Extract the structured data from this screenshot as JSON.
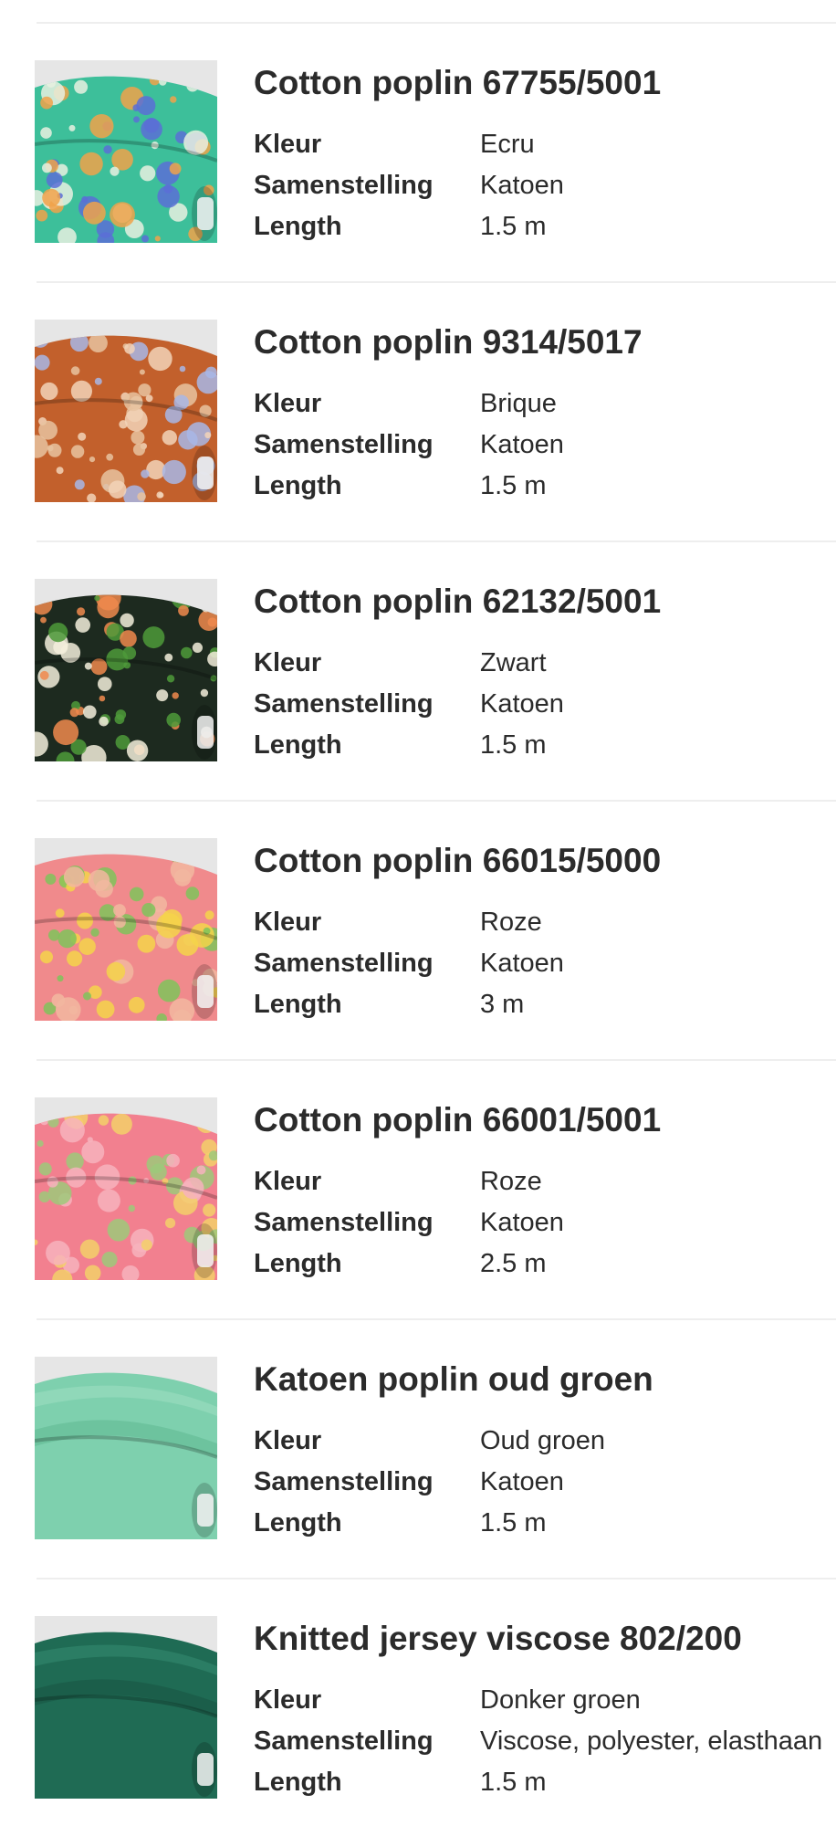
{
  "labels": {
    "kleur": "Kleur",
    "samenstelling": "Samenstelling",
    "length": "Length"
  },
  "products": [
    {
      "title": "Cotton poplin 67755/5001",
      "kleur": "Ecru",
      "samenstelling": "Katoen",
      "length": "1.5 m",
      "colors": {
        "base": "#3dbf9a",
        "accent1": "#5a6fd6",
        "accent2": "#f0a24a",
        "accent3": "#e8f0e0"
      }
    },
    {
      "title": "Cotton poplin 9314/5017",
      "kleur": "Brique",
      "samenstelling": "Katoen",
      "length": "1.5 m",
      "colors": {
        "base": "#c2602c",
        "accent1": "#f2d3b8",
        "accent2": "#a8b7e6",
        "accent3": "#e7c3a0"
      }
    },
    {
      "title": "Cotton poplin 62132/5001",
      "kleur": "Zwart",
      "samenstelling": "Katoen",
      "length": "1.5 m",
      "colors": {
        "base": "#1d2a1f",
        "accent1": "#4d9a3a",
        "accent2": "#f08a4e",
        "accent3": "#f3eedc"
      }
    },
    {
      "title": "Cotton poplin 66015/5000",
      "kleur": "Roze",
      "samenstelling": "Katoen",
      "length": "3 m",
      "colors": {
        "base": "#f08a8c",
        "accent1": "#f4d34a",
        "accent2": "#7fc35a",
        "accent3": "#f2b7a0"
      }
    },
    {
      "title": "Cotton poplin 66001/5001",
      "kleur": "Roze",
      "samenstelling": "Katoen",
      "length": "2.5 m",
      "colors": {
        "base": "#f2808f",
        "accent1": "#f7b3bd",
        "accent2": "#f3d06a",
        "accent3": "#9dc97a"
      }
    },
    {
      "title": "Katoen poplin oud groen",
      "kleur": "Oud groen",
      "samenstelling": "Katoen",
      "length": "1.5 m",
      "colors": {
        "base": "#7ed0ae",
        "accent1": "#92dcbd",
        "accent2": "#5fb892",
        "accent3": "#a6e2c8"
      }
    },
    {
      "title": "Knitted jersey viscose 802/200",
      "kleur": "Donker groen",
      "samenstelling": "Viscose, polyester, elasthaan",
      "length": "1.5 m",
      "colors": {
        "base": "#1f6b54",
        "accent1": "#2a8066",
        "accent2": "#175442",
        "accent3": "#3a9478"
      }
    }
  ]
}
